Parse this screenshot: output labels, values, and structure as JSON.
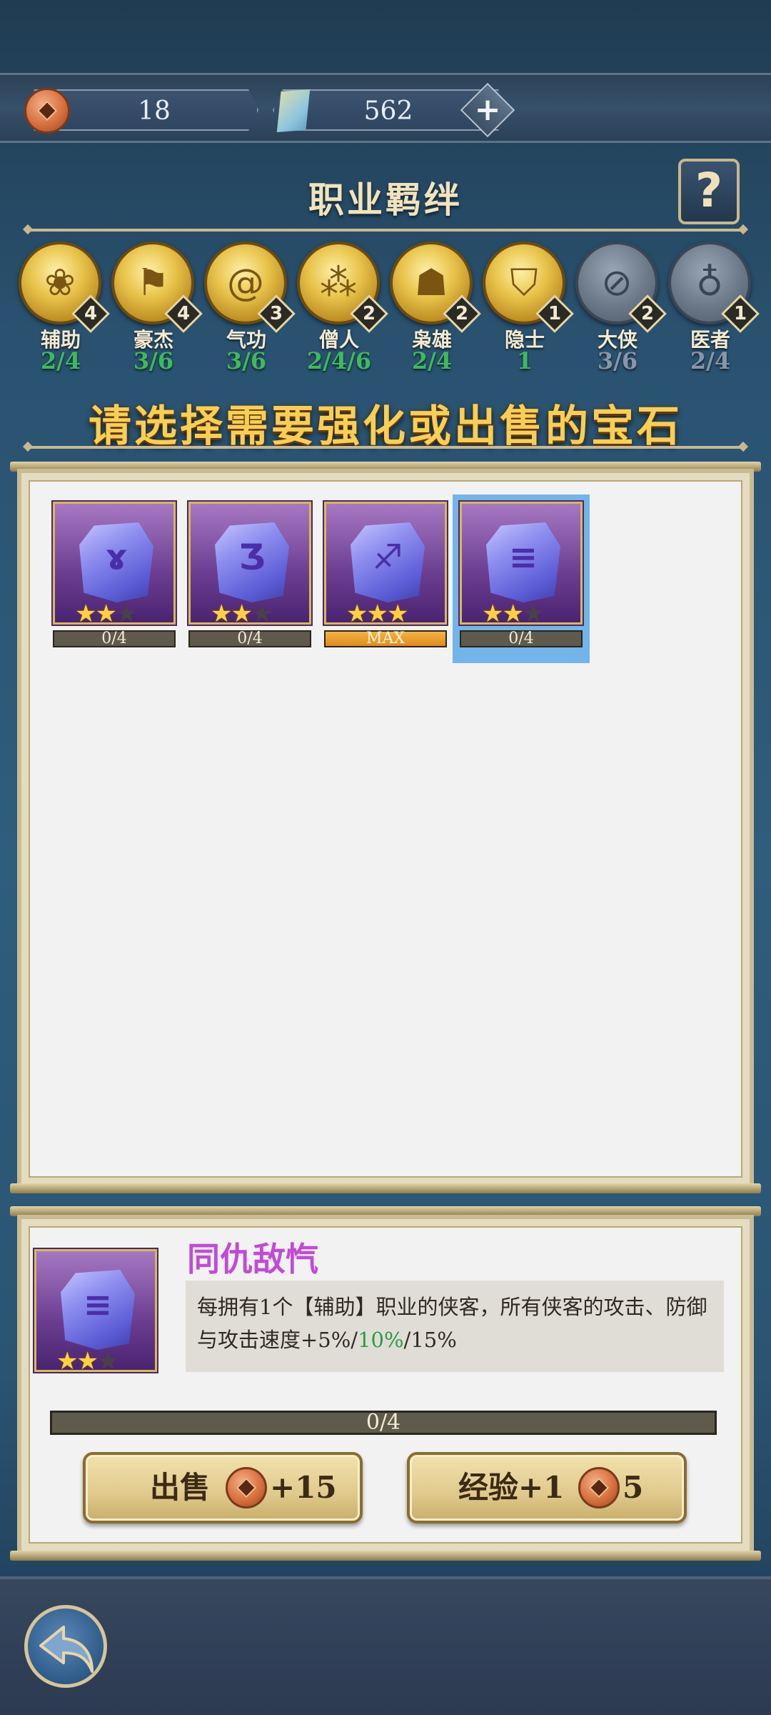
{
  "resources": {
    "coins": "18",
    "gems": "562"
  },
  "bonds": {
    "title": "职业羁绊",
    "help": "?",
    "items": [
      {
        "name": "辅助",
        "count": "4",
        "level": "2/4",
        "active": true,
        "icon": "lotus-icon"
      },
      {
        "name": "豪杰",
        "count": "4",
        "level": "3/6",
        "active": true,
        "icon": "banner-icon"
      },
      {
        "name": "气功",
        "count": "3",
        "level": "3/6",
        "active": true,
        "icon": "swirl-icon"
      },
      {
        "name": "僧人",
        "count": "2",
        "level": "2/4/6",
        "active": true,
        "icon": "prayer-beads-icon"
      },
      {
        "name": "枭雄",
        "count": "2",
        "level": "2/4",
        "active": true,
        "icon": "demon-mask-icon"
      },
      {
        "name": "隐士",
        "count": "1",
        "level": "1",
        "active": true,
        "icon": "straw-hat-icon"
      },
      {
        "name": "大侠",
        "count": "2",
        "level": "3/6",
        "active": false,
        "icon": "sword-ring-icon"
      },
      {
        "name": "医者",
        "count": "1",
        "level": "2/4",
        "active": false,
        "icon": "gourd-icon"
      }
    ]
  },
  "prompt": "请选择需要强化或出售的宝石",
  "gems": [
    {
      "rune": "ɤ",
      "stars": 2,
      "progress": "0/4",
      "max": false,
      "selected": false
    },
    {
      "rune": "Ʒ",
      "stars": 2,
      "progress": "0/4",
      "max": false,
      "selected": false
    },
    {
      "rune": "♐",
      "stars": 3,
      "progress": "MAX",
      "max": true,
      "selected": false
    },
    {
      "rune": "≡",
      "stars": 2,
      "progress": "0/4",
      "max": false,
      "selected": true
    }
  ],
  "detail": {
    "name": "同仇敌忾",
    "rune": "≡",
    "stars": 2,
    "desc_before": "每拥有1个【辅助】职业的侠客，所有侠客的攻击、防御与攻击速度+5%/",
    "desc_highlight": "10%",
    "desc_after": "/15%",
    "progress": "0/4"
  },
  "buttons": {
    "sell_label": "出售",
    "sell_value": "+15",
    "exp_label": "经验+1",
    "exp_cost": "5"
  },
  "colors": {
    "bond_level_active": "#3dbb5a",
    "bond_level_inactive": "#8a96a6"
  }
}
